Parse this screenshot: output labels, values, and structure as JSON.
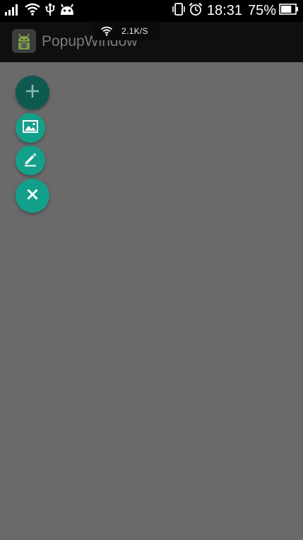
{
  "status_bar": {
    "time": "18:31",
    "battery_percent": "75%",
    "battery_level": 0.75,
    "icons_left": [
      "signal-icon",
      "wifi-icon",
      "usb-icon",
      "android-debug-icon"
    ],
    "icons_right": [
      "vibrate-icon",
      "alarm-icon",
      "battery-icon"
    ]
  },
  "network_toast": {
    "speed": "2.1K/S"
  },
  "action_bar": {
    "title": "PopupWindow",
    "app_icon": "android-app-icon"
  },
  "fab_menu": {
    "items": [
      {
        "icon": "plus-icon",
        "color": "#0e5a50"
      },
      {
        "icon": "image-icon",
        "color": "#13a08a"
      },
      {
        "icon": "pencil-icon",
        "color": "#13a08a"
      },
      {
        "icon": "close-icon",
        "color": "#13a08a"
      }
    ]
  },
  "colors": {
    "background_dim": "#6a6a6a",
    "status_bar": "#000000",
    "action_bar": "#0f0f0f",
    "fab_primary_dark": "#0e5a50",
    "fab_teal": "#13a08a"
  }
}
